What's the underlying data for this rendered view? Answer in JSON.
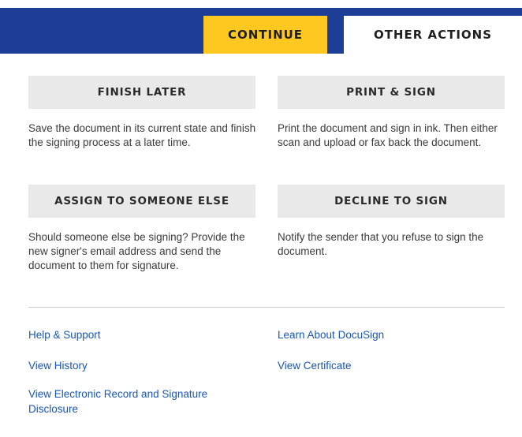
{
  "tabs": {
    "continue_label": "CONTINUE",
    "other_actions_label": "OTHER ACTIONS"
  },
  "actions": {
    "finish_later": {
      "label": "FINISH LATER",
      "description": "Save the document in its current state and finish the signing process at a later time."
    },
    "print_sign": {
      "label": "PRINT & SIGN",
      "description": "Print the document and sign in ink. Then either scan and upload or fax back the document."
    },
    "assign": {
      "label": "ASSIGN TO SOMEONE ELSE",
      "description": "Should someone else be signing? Provide the new signer's email address and send the document to them for signature."
    },
    "decline": {
      "label": "DECLINE TO SIGN",
      "description": "Notify the sender that you refuse to sign the document."
    }
  },
  "links": {
    "help_support": "Help & Support",
    "learn_about": "Learn About DocuSign",
    "view_history": "View History",
    "view_certificate": "View Certificate",
    "view_disclosure": "View Electronic Record and Signature Disclosure"
  },
  "colors": {
    "header_blue": "#1c3e96",
    "continue_yellow": "#ffc820",
    "button_gray": "#e9e9e9",
    "link_blue": "#1a56b0"
  }
}
